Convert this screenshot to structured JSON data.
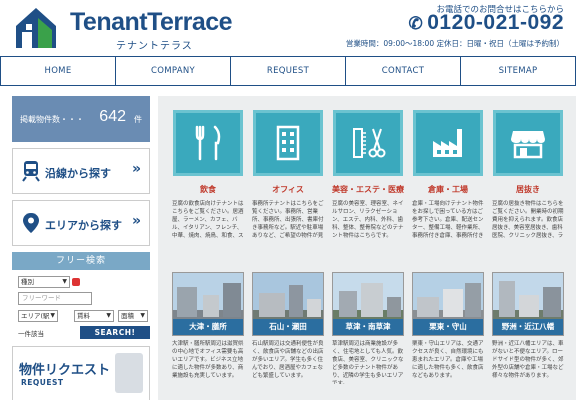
{
  "header": {
    "logo_main": "TenantTerrace",
    "logo_sub": "テナントテラス",
    "contact_note": "お電話でのお問合せはこちらから",
    "phone": "0120-021-092",
    "hours": "営業時間：09:00～18:00 定休日：日曜・祝日（土曜は予約制）"
  },
  "nav": {
    "items": [
      {
        "label": "HOME"
      },
      {
        "label": "COMPANY"
      },
      {
        "label": "REQUEST"
      },
      {
        "label": "CONTACT"
      },
      {
        "label": "SITEMAP"
      }
    ]
  },
  "sidebar": {
    "count_label": "掲載物件数・・・",
    "count_value": "642",
    "count_unit": "件",
    "search_line": "沿線から探す",
    "search_area": "エリアから探す",
    "chevron": "»",
    "free_search_title": "フリー検索",
    "type_select": "種別",
    "free_word_placeholder": "フリーワード",
    "area_select": "エリア(駅",
    "rent_select": "賃料",
    "size_select": "面積",
    "only_this": "一件該当",
    "search_button": "SEARCH!",
    "request_title": "物件リクエスト",
    "request_sub": "REQUEST"
  },
  "categories": [
    {
      "name": "飲食",
      "icon": "fork-knife-icon",
      "desc": "豆腐の飲食店向けテナントはこちらをご覧ください。居酒屋、ラーメン、カフェ、バル、イタリアン、フレンチ、中華、焼肉、焼鳥、和食、スナック、バーなど。"
    },
    {
      "name": "オフィス",
      "icon": "building-icon",
      "desc": "事務所テナントはこちらをご覧ください。事務所、営業所、事務所、出張所、書庫付き事務所など。駅近や駐車場ありなど、ご希望の物件が見つかります。"
    },
    {
      "name": "美容・エステ・医療",
      "icon": "comb-scissors-icon",
      "desc": "豆腐の美容室、理容室、ネイルサロン、リラクゼーション、エステ、内科、外科、歯科、整体、整骨院などのテナント物件はこちらです。"
    },
    {
      "name": "倉庫・工場",
      "icon": "factory-icon",
      "desc": "倉庫・工場向けテナント物件をお探しで困っている方はご参考下さい。倉庫、配送センター、整備工場、軽作業所、事務所付き倉庫、事務所付き工場など。"
    },
    {
      "name": "居抜き",
      "icon": "storefront-icon",
      "desc": "豆腐の居抜き物件はこちらをご覧ください。開業時の初期費用を抑えられます。飲食店居抜き、美容室居抜き、歯科医院、クリニック居抜き、ラーメン店居抜き、居酒屋居抜き等。"
    }
  ],
  "areas": [
    {
      "name": "大津・膳所",
      "desc": "大津駅・膳所駅周辺は滋賀県の中心地でオフィス需要も高いエリアです。ビジネス立地に適した物件が多数あり、商業施設も充実しています。"
    },
    {
      "name": "石山・瀬田",
      "desc": "石山駅周辺は交通利便性が良く、飲食店や店舗などの出店が多いエリア。学生も多く住んでおり、居酒屋やカフェなども繁盛しています。"
    },
    {
      "name": "草津・南草津",
      "desc": "草津駅周辺は商業施設が多く、住宅地としても人気。飲食店、美容室、クリニックなど多数のテナント物件があり、近隣の学生も多いエリアです。"
    },
    {
      "name": "栗東・守山",
      "desc": "栗東・守山エリアは、交通アクセスが良く、自然環境にも恵まれたエリア。倉庫や工場に適した物件も多く、飲食店などもあります。"
    },
    {
      "name": "野洲・近江八幡",
      "desc": "野洲・近江八幡エリアは、車がないと不便なエリア。ロードサイド型の物件が多く、郊外型の店舗や倉庫・工場など様々な物件があります。"
    }
  ],
  "colors": {
    "brand": "#1f4f86",
    "tile": "#3aa9bd",
    "accent_red": "#c0392b",
    "sidebar_count_bg": "#6a8cb3",
    "main_bg": "#eceeef"
  }
}
